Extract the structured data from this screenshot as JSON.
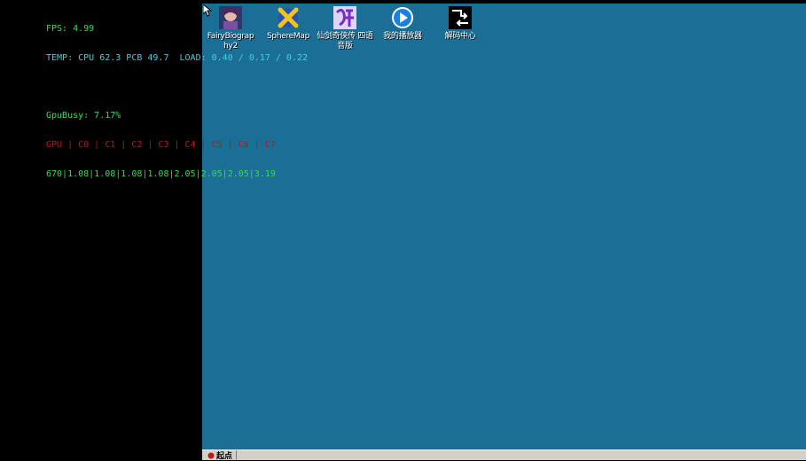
{
  "overlay": {
    "fps": "FPS: 4.99",
    "temp": "TEMP: CPU 62.3 PCB 49.7  LOAD: 0.40 / 0.17 / 0.22",
    "gpubusy": "GpuBusy: 7.17%",
    "freq_header": "GPU | C0 | C1 | C2 | C3 | C4 | C5 | C6 | C7",
    "freq_values": "670|1.08|1.08|1.08|1.08|2.05|2.05|2.05|3.19"
  },
  "desktop": {
    "icons": [
      {
        "label": "FairyBiograp hy2",
        "icon": "fairy-biography-icon"
      },
      {
        "label": "SphereMap",
        "icon": "spheremap-icon"
      },
      {
        "label": "仙剑奇侠传 四语音版",
        "icon": "xianjian-icon"
      },
      {
        "label": "我的播放器",
        "icon": "media-player-icon"
      },
      {
        "label": "解码中心",
        "icon": "decoder-center-icon"
      }
    ]
  },
  "taskbar": {
    "start_label": "起点"
  },
  "colors": {
    "desktop": "#1b6f96",
    "overlay_green": "#33e04a",
    "overlay_cyan": "#3fd0e0",
    "overlay_red": "#cc1010"
  }
}
